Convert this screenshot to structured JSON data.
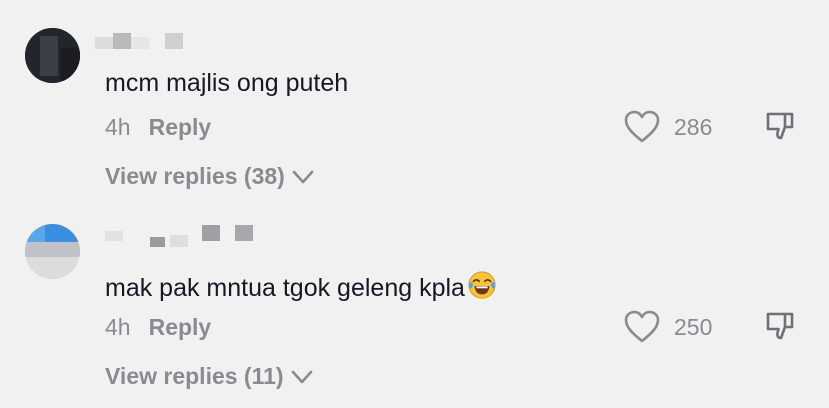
{
  "comments": [
    {
      "text": "mcm majlis ong puteh",
      "emoji": "",
      "time": "4h",
      "reply_label": "Reply",
      "likes": "286",
      "view_replies": "View replies (38)"
    },
    {
      "text": "mak pak mntua tgok geleng kpla",
      "emoji": "face-with-tears-of-joy",
      "time": "4h",
      "reply_label": "Reply",
      "likes": "250",
      "view_replies": "View replies (11)"
    }
  ],
  "colors": {
    "background": "#f1f1f2",
    "text": "#161823",
    "muted": "#8a8b91"
  },
  "icons": [
    "heart-icon",
    "thumbs-down-icon",
    "chevron-down-icon"
  ]
}
